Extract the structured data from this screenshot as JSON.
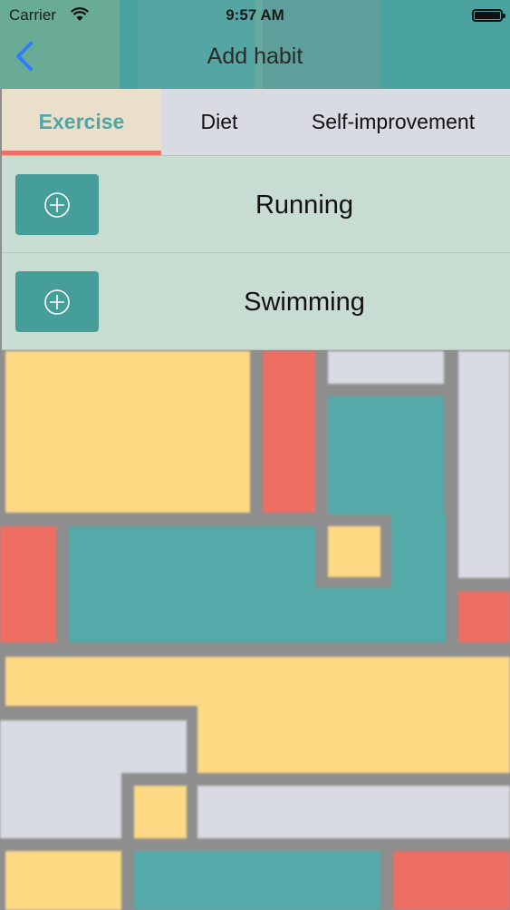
{
  "status_bar": {
    "carrier": "Carrier",
    "time": "9:57 AM"
  },
  "nav": {
    "title": "Add habit",
    "back_icon": "chevron-left-icon"
  },
  "tabs": [
    {
      "label": "Exercise",
      "active": true
    },
    {
      "label": "Diet",
      "active": false
    },
    {
      "label": "Self-improvement",
      "active": false
    }
  ],
  "habits": [
    {
      "label": "Running",
      "icon": "plus-circle-icon"
    },
    {
      "label": "Swimming",
      "icon": "plus-circle-icon"
    }
  ],
  "colors": {
    "teal": "#479f9c",
    "accent_red": "#ee6e63",
    "yellow": "#ffd983",
    "light_gray": "#d8dbe2",
    "active_tab_bg": "#e9dfca",
    "active_tab_text": "#4ea7a5",
    "row_bg": "#c9dcd2"
  }
}
